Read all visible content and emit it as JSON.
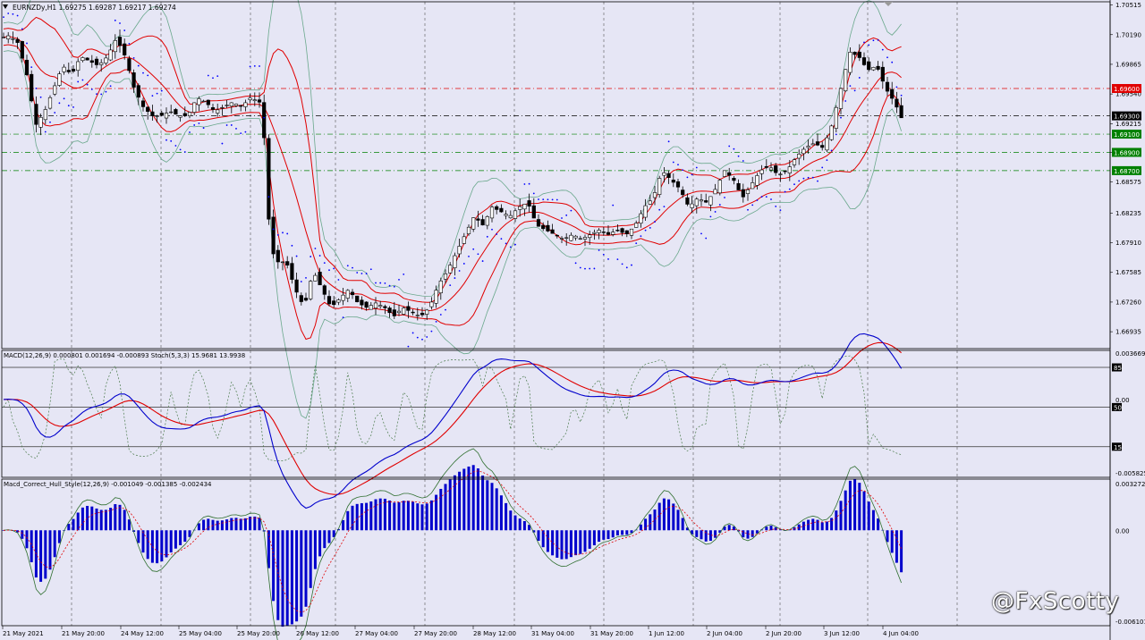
{
  "window": {
    "symbol_line": "EURNZDy,H1  1.69275 1.69287 1.69217 1.69274",
    "macd_line": "MACD(12,26,9) 0.000801 0.001694 -0.000893  Stoch(5,3,3) 15.9681 13.9938",
    "hull_line": "Macd_Correct_Hull_Style(12,26,9) -0.001049 -0.001385 -0.002434",
    "watermark": "@FxScotty"
  },
  "colors": {
    "background": "#e6e6f5",
    "candle": "#000000",
    "bollinger_inner": "#e00000",
    "bollinger_outer": "#6aa88c",
    "parabolic_sar": "#0000ff",
    "macd_main": "#0000cc",
    "macd_signal": "#e00000",
    "stoch": "#4a7a4a",
    "hull_hist": "#0000cc",
    "hull_line": "#2f6f2f",
    "hull_signal": "#e00000",
    "level_red": "#e00000",
    "level_green": "#008000"
  },
  "chart_data": [
    {
      "type": "candlestick",
      "panel": "price",
      "symbol": "EURNZDy",
      "timeframe": "H1",
      "ylim": [
        1.6675,
        1.7055
      ],
      "y_ticks": [
        "1.70515",
        "1.70190",
        "1.69865",
        "1.69540",
        "1.69215",
        "1.68900",
        "1.68575",
        "1.68235",
        "1.67910",
        "1.67585",
        "1.67260",
        "1.66935"
      ],
      "x_ticks": [
        "21 May 2021",
        "21 May 20:00",
        "24 May 12:00",
        "25 May 04:00",
        "25 May 20:00",
        "26 May 12:00",
        "27 May 04:00",
        "27 May 20:00",
        "28 May 12:00",
        "31 May 04:00",
        "31 May 20:00",
        "1 Jun 12:00",
        "2 Jun 04:00",
        "2 Jun 20:00",
        "3 Jun 12:00",
        "4 Jun 04:00"
      ],
      "levels": [
        {
          "label": "1.69600",
          "value": 1.696,
          "color": "#e00000"
        },
        {
          "label": "1.69300",
          "value": 1.693,
          "color": "#000000"
        },
        {
          "label": "1.69100",
          "value": 1.691,
          "color": "#008000"
        },
        {
          "label": "1.68900",
          "value": 1.689,
          "color": "#008000"
        },
        {
          "label": "1.68700",
          "value": 1.687,
          "color": "#008000"
        }
      ],
      "close_path": [
        [
          0,
          1.7015
        ],
        [
          10,
          1.7018
        ],
        [
          20,
          1.701
        ],
        [
          30,
          1.6975
        ],
        [
          40,
          1.692
        ],
        [
          50,
          1.6935
        ],
        [
          60,
          1.696
        ],
        [
          70,
          1.6985
        ],
        [
          80,
          1.6975
        ],
        [
          90,
          1.6995
        ],
        [
          100,
          1.699
        ],
        [
          110,
          1.6985
        ],
        [
          120,
          1.6995
        ],
        [
          130,
          1.7015
        ],
        [
          140,
          1.6995
        ],
        [
          150,
          1.696
        ],
        [
          160,
          1.694
        ],
        [
          170,
          1.693
        ],
        [
          180,
          1.693
        ],
        [
          190,
          1.6935
        ],
        [
          200,
          1.693
        ],
        [
          210,
          1.693
        ],
        [
          220,
          1.695
        ],
        [
          230,
          1.6945
        ],
        [
          240,
          1.6935
        ],
        [
          250,
          1.694
        ],
        [
          260,
          1.6945
        ],
        [
          270,
          1.694
        ],
        [
          280,
          1.695
        ],
        [
          290,
          1.6945
        ],
        [
          296,
          1.69
        ],
        [
          300,
          1.682
        ],
        [
          305,
          1.678
        ],
        [
          310,
          1.677
        ],
        [
          320,
          1.677
        ],
        [
          330,
          1.674
        ],
        [
          340,
          1.672
        ],
        [
          350,
          1.676
        ],
        [
          360,
          1.674
        ],
        [
          370,
          1.672
        ],
        [
          380,
          1.673
        ],
        [
          390,
          1.674
        ],
        [
          400,
          1.6725
        ],
        [
          410,
          1.672
        ],
        [
          420,
          1.6725
        ],
        [
          430,
          1.672
        ],
        [
          440,
          1.671
        ],
        [
          450,
          1.672
        ],
        [
          460,
          1.6715
        ],
        [
          470,
          1.671
        ],
        [
          480,
          1.672
        ],
        [
          490,
          1.6745
        ],
        [
          500,
          1.676
        ],
        [
          510,
          1.678
        ],
        [
          520,
          1.68
        ],
        [
          530,
          1.682
        ],
        [
          540,
          1.681
        ],
        [
          550,
          1.683
        ],
        [
          560,
          1.6825
        ],
        [
          570,
          1.682
        ],
        [
          580,
          1.683
        ],
        [
          590,
          1.6835
        ],
        [
          600,
          1.681
        ],
        [
          610,
          1.6805
        ],
        [
          620,
          1.68
        ],
        [
          630,
          1.6795
        ],
        [
          640,
          1.68
        ],
        [
          650,
          1.6795
        ],
        [
          660,
          1.68
        ],
        [
          670,
          1.6805
        ],
        [
          680,
          1.68
        ],
        [
          690,
          1.6805
        ],
        [
          700,
          1.68
        ],
        [
          710,
          1.681
        ],
        [
          720,
          1.683
        ],
        [
          730,
          1.684
        ],
        [
          740,
          1.687
        ],
        [
          750,
          1.686
        ],
        [
          760,
          1.685
        ],
        [
          770,
          1.683
        ],
        [
          780,
          1.684
        ],
        [
          790,
          1.6835
        ],
        [
          800,
          1.685
        ],
        [
          810,
          1.687
        ],
        [
          820,
          1.686
        ],
        [
          830,
          1.684
        ],
        [
          840,
          1.6855
        ],
        [
          850,
          1.687
        ],
        [
          860,
          1.6875
        ],
        [
          870,
          1.6865
        ],
        [
          880,
          1.687
        ],
        [
          890,
          1.6885
        ],
        [
          900,
          1.6895
        ],
        [
          910,
          1.69
        ],
        [
          920,
          1.6895
        ],
        [
          930,
          1.692
        ],
        [
          940,
          1.696
        ],
        [
          950,
          1.7
        ],
        [
          960,
          1.6995
        ],
        [
          970,
          1.698
        ],
        [
          980,
          1.6985
        ],
        [
          990,
          1.696
        ],
        [
          1000,
          1.6945
        ],
        [
          1008,
          1.6927
        ]
      ]
    },
    {
      "type": "line",
      "panel": "macd_stoch",
      "ylim": [
        -0.005825,
        0.003669
      ],
      "y_ticks": [
        "0.003669",
        "85",
        "0.00",
        "50",
        "15",
        "-0.005825"
      ],
      "stoch_levels": [
        85,
        50,
        15
      ]
    },
    {
      "type": "bar",
      "panel": "hull_macd",
      "ylim": [
        -0.006101,
        0.003272
      ],
      "y_ticks": [
        "0.003272",
        "0.00",
        "-0.006101"
      ]
    }
  ]
}
